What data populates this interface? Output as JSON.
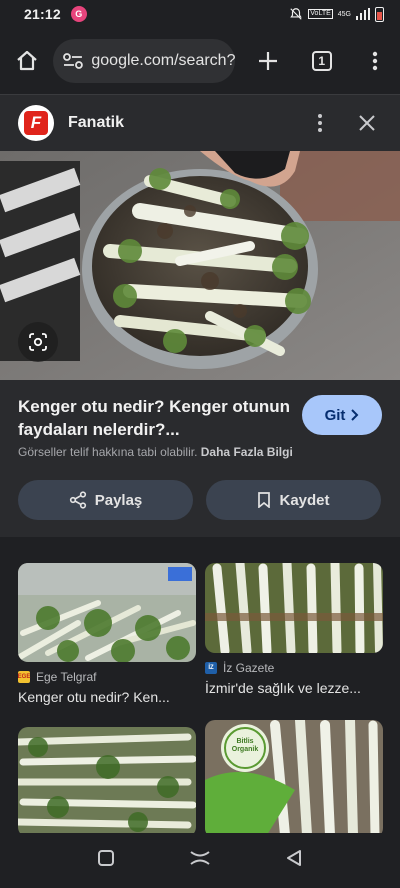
{
  "status_bar": {
    "time": "21:12",
    "notification_badge": "G",
    "network_label_top": "VoLTE",
    "network_label_mid": "4G",
    "network_label_side": "45G"
  },
  "browser": {
    "url": "google.com/search?",
    "tab_count": "1"
  },
  "panel": {
    "site_name": "Fanatik",
    "title": "Kenger otu nedir? Kenger otunun faydaları nelerdir?...",
    "visit_button": "Git",
    "copyright_text": "Görseller telif hakkına tabi olabilir.",
    "more_info_link": "Daha Fazla Bilgi",
    "share_button": "Paylaş",
    "save_button": "Kaydet"
  },
  "results": [
    {
      "source": "Ege Telgraf",
      "title": "Kenger otu nedir? Ken..."
    },
    {
      "source": "İz Gazete",
      "title": "İzmir'de sağlık ve lezze..."
    },
    {
      "source": "",
      "title": ""
    },
    {
      "source": "",
      "title": "",
      "logo_text": "Bitlis Organik"
    }
  ],
  "colors": {
    "accent": "#a8c7fa",
    "background": "#1f2023",
    "panel": "#2a2b2e",
    "button": "#3b4350"
  }
}
